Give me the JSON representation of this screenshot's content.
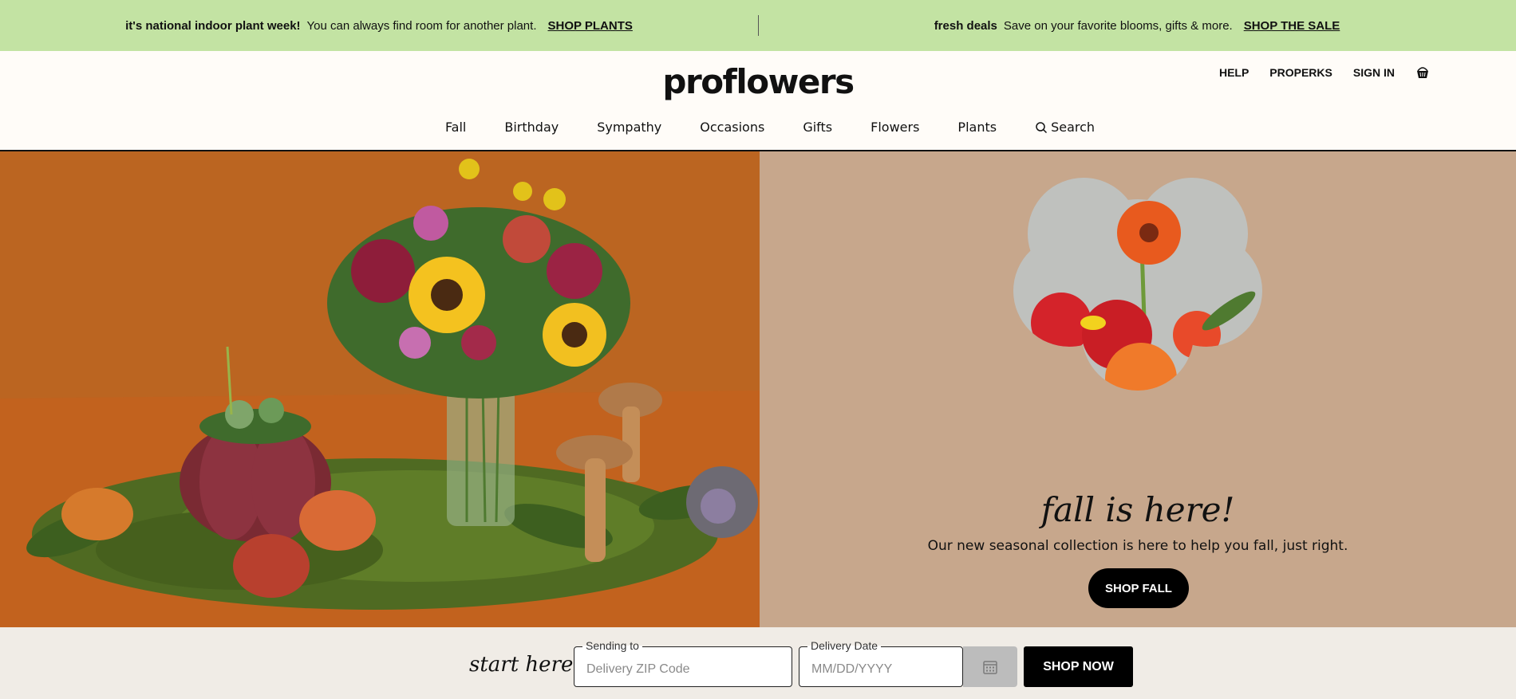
{
  "promo": {
    "left": {
      "bold": "it's national indoor plant week!",
      "text": "You can always find room for another plant.",
      "link": "SHOP PLANTS"
    },
    "right": {
      "bold": "fresh deals",
      "text": "Save on your favorite blooms, gifts & more.",
      "link": "SHOP THE SALE"
    }
  },
  "header": {
    "logo": "proflowers",
    "utility": {
      "help": "HELP",
      "properks": "PROPERKS",
      "sign_in": "SIGN IN"
    }
  },
  "nav": {
    "items": [
      "Fall",
      "Birthday",
      "Sympathy",
      "Occasions",
      "Gifts",
      "Flowers",
      "Plants"
    ],
    "search_label": "Search"
  },
  "hero": {
    "title": "fall is here!",
    "subtitle": "Our new seasonal collection is here to help you fall, just right.",
    "button": "SHOP FALL"
  },
  "start_bar": {
    "label": "start here",
    "zip": {
      "legend": "Sending to",
      "placeholder": "Delivery ZIP Code"
    },
    "date": {
      "legend": "Delivery Date",
      "placeholder": "MM/DD/YYYY"
    },
    "calendar_icon": "calendar-icon",
    "button": "SHOP NOW"
  },
  "colors": {
    "promo_bg": "#c3e3a3",
    "hero_right_bg": "#c7a78c",
    "start_bar_bg": "#f0ece6",
    "primary_button": "#000000"
  }
}
